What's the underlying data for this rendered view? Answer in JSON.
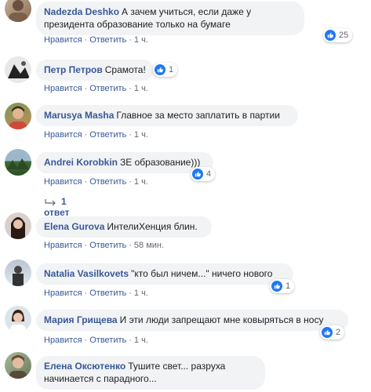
{
  "comments": [
    {
      "author": "Nadezda Deshko",
      "text": "А зачем учиться, если даже у президента образование только на бумаге",
      "like_label": "Нравится",
      "reply_label": "Ответить",
      "time": "1 ч.",
      "reactions": "25"
    },
    {
      "author": "Петр Петров",
      "text": "Срамота!",
      "like_label": "Нравится",
      "reply_label": "Ответить",
      "time": "1 ч.",
      "reactions": "1"
    },
    {
      "author": "Marusya Masha",
      "text": "Главное за место заплатить в партии",
      "like_label": "Нравится",
      "reply_label": "Ответить",
      "time": "1 ч.",
      "reactions": ""
    },
    {
      "author": "Andrei Korobkin",
      "text": "ЗЕ образование)))",
      "like_label": "Нравится",
      "reply_label": "Ответить",
      "time": "1 ч.",
      "reactions": "4",
      "replies_label": "1 ответ"
    },
    {
      "author": "Elena Gurova",
      "text": "ИнтелиХенция блин.",
      "like_label": "Нравится",
      "reply_label": "Ответить",
      "time": "58 мин.",
      "reactions": ""
    },
    {
      "author": "Natalia Vasilkovets",
      "text": "\"кто был ничем...\" ничего нового",
      "like_label": "Нравится",
      "reply_label": "Ответить",
      "time": "1 ч.",
      "reactions": "1"
    },
    {
      "author": "Мария Грищева",
      "text": "И эти люди запрещают мне ковыряться в носу",
      "like_label": "Нравится",
      "reply_label": "Ответить",
      "time": "1 ч.",
      "reactions": "2"
    },
    {
      "author": "Елена Оксютенко",
      "text": "Тушите свет... разруха начинается с парадного...",
      "reactions": ""
    }
  ],
  "colors": {
    "link": "#385898",
    "bubble": "#f2f3f5",
    "like_blue": "#2078f4",
    "meta": "#606770"
  }
}
